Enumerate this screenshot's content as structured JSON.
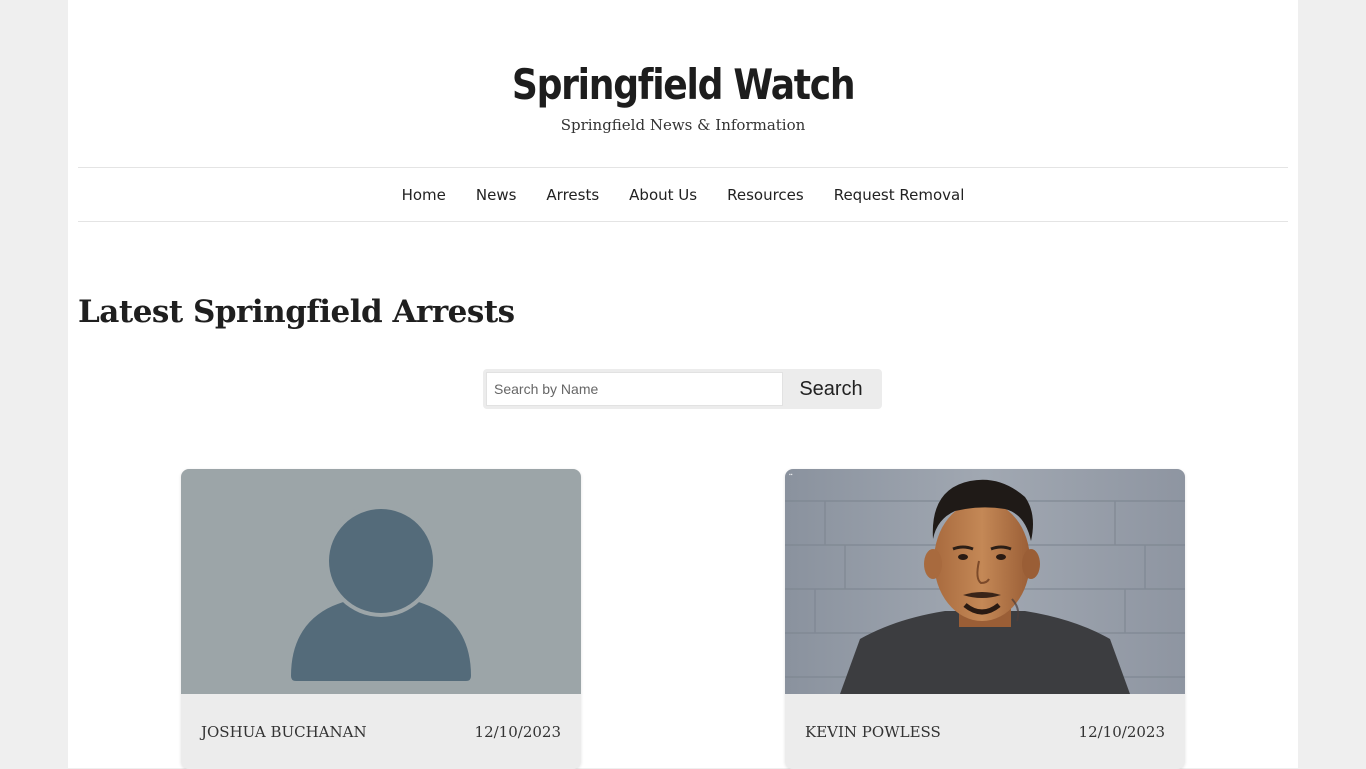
{
  "site": {
    "title": "Springfield Watch",
    "tagline": "Springfield News & Information"
  },
  "nav": {
    "items": [
      {
        "label": "Home"
      },
      {
        "label": "News"
      },
      {
        "label": "Arrests"
      },
      {
        "label": "About Us"
      },
      {
        "label": "Resources"
      },
      {
        "label": "Request Removal"
      }
    ]
  },
  "main": {
    "heading": "Latest Springfield Arrests"
  },
  "search": {
    "placeholder": "Search by Name",
    "value": "",
    "button_label": "Search"
  },
  "arrests": [
    {
      "name": "JOSHUA BUCHANAN",
      "date": "12/10/2023",
      "photo": "placeholder-avatar-icon"
    },
    {
      "name": "KEVIN POWLESS",
      "date": "12/10/2023",
      "photo": "mugshot-photo"
    }
  ],
  "colors": {
    "page_background": "#efefef",
    "content_background": "#ffffff",
    "card_background": "#ececec",
    "avatar_background": "#9ca5a8",
    "avatar_figure": "#546b7a"
  }
}
